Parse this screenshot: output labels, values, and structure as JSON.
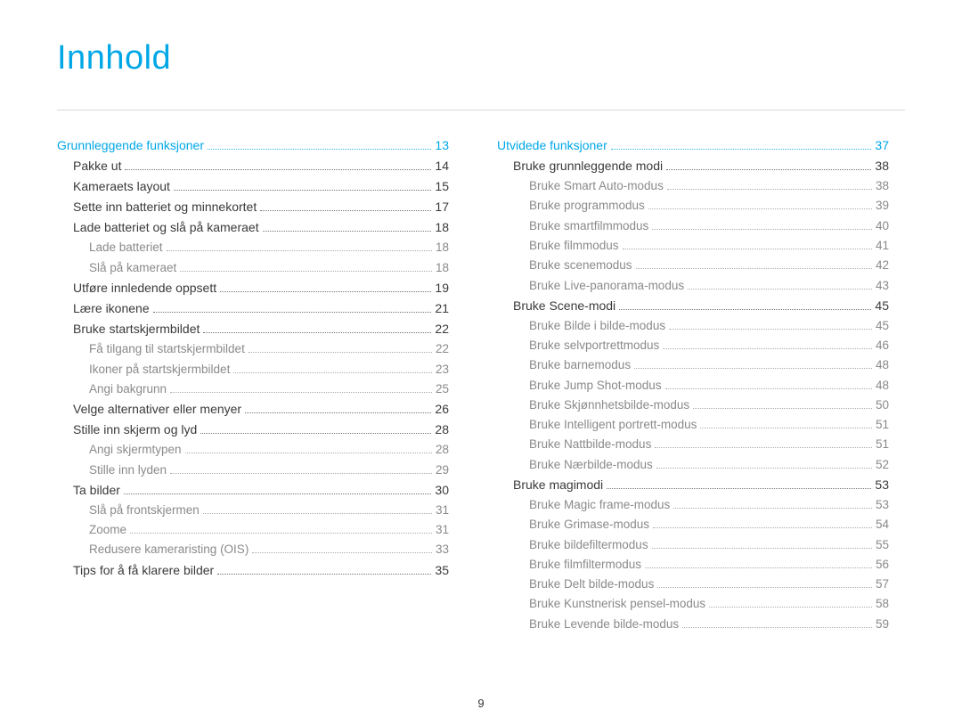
{
  "title": "Innhold",
  "page_number": "9",
  "columns": [
    [
      {
        "label": "Grunnleggende funksjoner",
        "page": "13",
        "level": "section",
        "indent": 0
      },
      {
        "label": "Pakke ut",
        "page": "14",
        "level": "sub1",
        "indent": 1
      },
      {
        "label": "Kameraets layout",
        "page": "15",
        "level": "sub1",
        "indent": 1
      },
      {
        "label": "Sette inn batteriet og minnekortet",
        "page": "17",
        "level": "sub1",
        "indent": 1
      },
      {
        "label": "Lade batteriet og slå på kameraet",
        "page": "18",
        "level": "sub1",
        "indent": 1
      },
      {
        "label": "Lade batteriet",
        "page": "18",
        "level": "sub2",
        "indent": 2
      },
      {
        "label": "Slå på kameraet",
        "page": "18",
        "level": "sub2",
        "indent": 2
      },
      {
        "label": "Utføre innledende oppsett",
        "page": "19",
        "level": "sub1",
        "indent": 1
      },
      {
        "label": "Lære ikonene",
        "page": "21",
        "level": "sub1",
        "indent": 1
      },
      {
        "label": "Bruke startskjermbildet",
        "page": "22",
        "level": "sub1",
        "indent": 1
      },
      {
        "label": "Få tilgang til startskjermbildet",
        "page": "22",
        "level": "sub2",
        "indent": 2
      },
      {
        "label": "Ikoner på startskjermbildet",
        "page": "23",
        "level": "sub2",
        "indent": 2
      },
      {
        "label": "Angi bakgrunn",
        "page": "25",
        "level": "sub2",
        "indent": 2
      },
      {
        "label": "Velge alternativer eller menyer",
        "page": "26",
        "level": "sub1",
        "indent": 1
      },
      {
        "label": "Stille inn skjerm og lyd",
        "page": "28",
        "level": "sub1",
        "indent": 1
      },
      {
        "label": "Angi skjermtypen",
        "page": "28",
        "level": "sub2",
        "indent": 2
      },
      {
        "label": "Stille inn lyden",
        "page": "29",
        "level": "sub2",
        "indent": 2
      },
      {
        "label": "Ta bilder",
        "page": "30",
        "level": "sub1",
        "indent": 1
      },
      {
        "label": "Slå på frontskjermen",
        "page": "31",
        "level": "sub2",
        "indent": 2
      },
      {
        "label": "Zoome",
        "page": "31",
        "level": "sub2",
        "indent": 2
      },
      {
        "label": "Redusere kameraristing (OIS)",
        "page": "33",
        "level": "sub2",
        "indent": 2
      },
      {
        "label": "Tips for å få klarere bilder",
        "page": "35",
        "level": "sub1",
        "indent": 1
      }
    ],
    [
      {
        "label": "Utvidede funksjoner",
        "page": "37",
        "level": "section",
        "indent": 0
      },
      {
        "label": "Bruke grunnleggende modi",
        "page": "38",
        "level": "sub1",
        "indent": 1
      },
      {
        "label": "Bruke Smart Auto-modus",
        "page": "38",
        "level": "sub2",
        "indent": 2
      },
      {
        "label": "Bruke programmodus",
        "page": "39",
        "level": "sub2",
        "indent": 2
      },
      {
        "label": "Bruke smartfilmmodus",
        "page": "40",
        "level": "sub2",
        "indent": 2
      },
      {
        "label": "Bruke filmmodus",
        "page": "41",
        "level": "sub2",
        "indent": 2
      },
      {
        "label": "Bruke scenemodus",
        "page": "42",
        "level": "sub2",
        "indent": 2
      },
      {
        "label": "Bruke Live-panorama-modus",
        "page": "43",
        "level": "sub2",
        "indent": 2
      },
      {
        "label": "Bruke Scene-modi",
        "page": "45",
        "level": "sub1",
        "indent": 1
      },
      {
        "label": "Bruke Bilde i bilde-modus",
        "page": "45",
        "level": "sub2",
        "indent": 2
      },
      {
        "label": "Bruke selvportrettmodus",
        "page": "46",
        "level": "sub2",
        "indent": 2
      },
      {
        "label": "Bruke barnemodus",
        "page": "48",
        "level": "sub2",
        "indent": 2
      },
      {
        "label": "Bruke Jump Shot-modus",
        "page": "48",
        "level": "sub2",
        "indent": 2
      },
      {
        "label": "Bruke Skjønnhetsbilde-modus",
        "page": "50",
        "level": "sub2",
        "indent": 2
      },
      {
        "label": "Bruke Intelligent portrett-modus",
        "page": "51",
        "level": "sub2",
        "indent": 2
      },
      {
        "label": "Bruke Nattbilde-modus",
        "page": "51",
        "level": "sub2",
        "indent": 2
      },
      {
        "label": "Bruke Nærbilde-modus",
        "page": "52",
        "level": "sub2",
        "indent": 2
      },
      {
        "label": "Bruke magimodi",
        "page": "53",
        "level": "sub1",
        "indent": 1
      },
      {
        "label": "Bruke Magic frame-modus",
        "page": "53",
        "level": "sub2",
        "indent": 2
      },
      {
        "label": "Bruke Grimase-modus",
        "page": "54",
        "level": "sub2",
        "indent": 2
      },
      {
        "label": "Bruke bildefiltermodus",
        "page": "55",
        "level": "sub2",
        "indent": 2
      },
      {
        "label": "Bruke filmfiltermodus",
        "page": "56",
        "level": "sub2",
        "indent": 2
      },
      {
        "label": "Bruke Delt bilde-modus",
        "page": "57",
        "level": "sub2",
        "indent": 2
      },
      {
        "label": "Bruke Kunstnerisk pensel-modus",
        "page": "58",
        "level": "sub2",
        "indent": 2
      },
      {
        "label": "Bruke Levende bilde-modus",
        "page": "59",
        "level": "sub2",
        "indent": 2
      }
    ]
  ]
}
